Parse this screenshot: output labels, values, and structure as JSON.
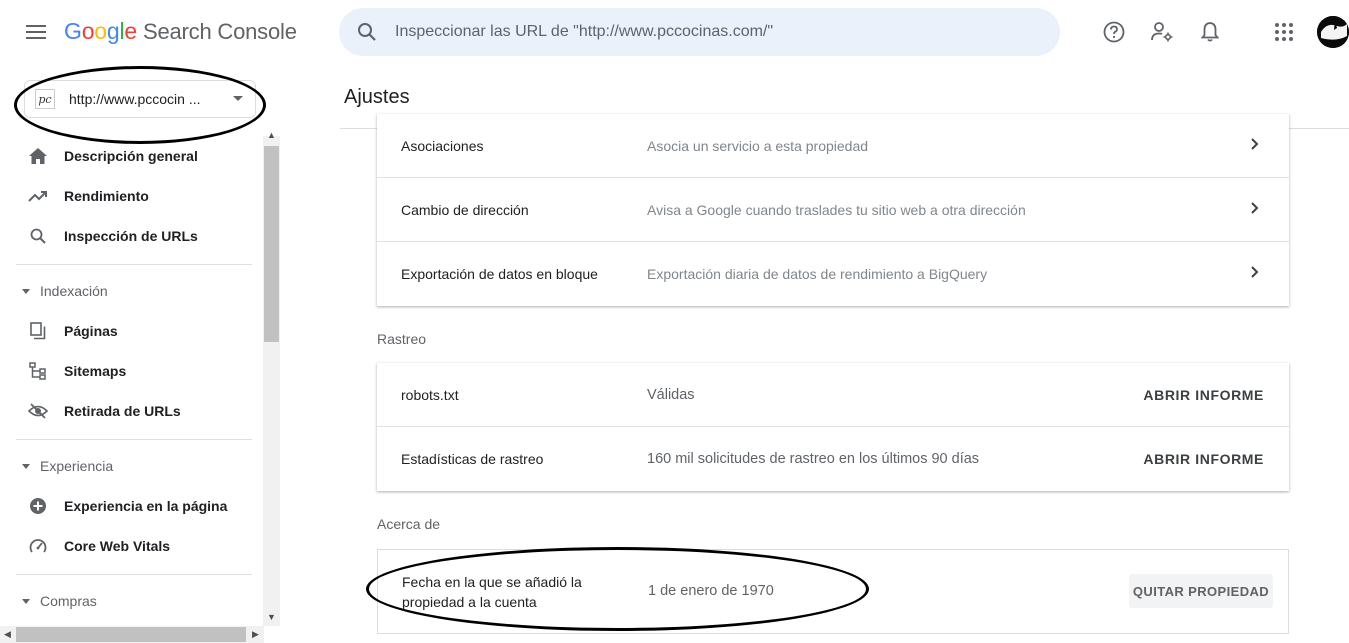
{
  "app": {
    "logo_google": [
      "G",
      "o",
      "o",
      "g",
      "l",
      "e"
    ],
    "logo_product": "Search Console"
  },
  "search": {
    "placeholder": "Inspeccionar las URL de \"http://www.pccocinas.com/\""
  },
  "property": {
    "favicon_text": "pc",
    "url": "http://www.pccocin ..."
  },
  "sidebar": {
    "items": [
      {
        "label": "Descripción general",
        "icon": "home-icon"
      },
      {
        "label": "Rendimiento",
        "icon": "trending-up-icon"
      },
      {
        "label": "Inspección de URLs",
        "icon": "search-icon"
      }
    ],
    "sections": [
      {
        "label": "Indexación",
        "items": [
          {
            "label": "Páginas",
            "icon": "pages-icon"
          },
          {
            "label": "Sitemaps",
            "icon": "sitemap-icon"
          },
          {
            "label": "Retirada de URLs",
            "icon": "visibility-off-icon"
          }
        ]
      },
      {
        "label": "Experiencia",
        "items": [
          {
            "label": "Experiencia en la página",
            "icon": "add-circle-icon"
          },
          {
            "label": "Core Web Vitals",
            "icon": "speed-icon"
          }
        ]
      },
      {
        "label": "Compras",
        "items": []
      }
    ]
  },
  "main": {
    "title": "Ajustes",
    "general_rows": [
      {
        "label": "Asociaciones",
        "desc": "Asocia un servicio a esta propiedad"
      },
      {
        "label": "Cambio de dirección",
        "desc": "Avisa a Google cuando traslades tu sitio web a otra dirección"
      },
      {
        "label": "Exportación de datos en bloque",
        "desc": "Exportación diaria de datos de rendimiento a BigQuery"
      }
    ],
    "crawl_section": "Rastreo",
    "crawl_rows": [
      {
        "label": "robots.txt",
        "desc": "Válidas",
        "action": "ABRIR INFORME"
      },
      {
        "label": "Estadísticas de rastreo",
        "desc": "160 mil solicitudes de rastreo en los últimos 90 días",
        "action": "ABRIR INFORME"
      }
    ],
    "about_section": "Acerca de",
    "about": {
      "label": "Fecha en la que se añadió la propiedad a la cuenta",
      "value": "1 de enero de 1970",
      "remove_label": "QUITAR PROPIEDAD"
    }
  },
  "colors": {
    "search_bg": "#eaf1fb",
    "annotation_ink": "#000000"
  }
}
